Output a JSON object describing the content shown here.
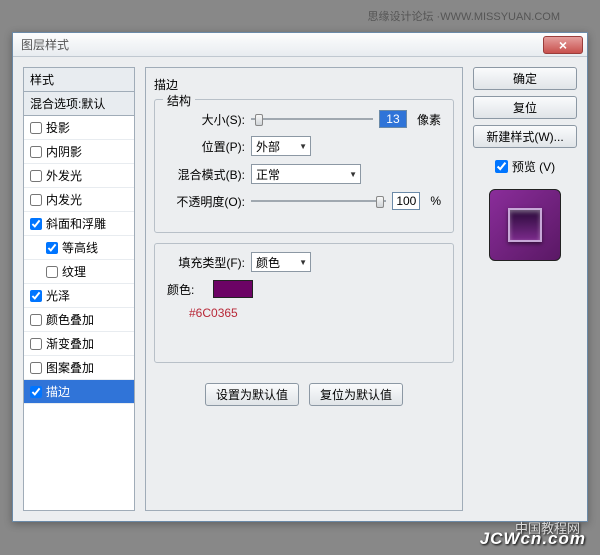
{
  "header_text": "思缘设计论坛 ·WWW.MISSYUAN.COM",
  "dialog": {
    "title": "图层样式"
  },
  "left": {
    "header": "样式",
    "blend": "混合选项:默认",
    "items": [
      {
        "label": "投影",
        "checked": false
      },
      {
        "label": "内阴影",
        "checked": false
      },
      {
        "label": "外发光",
        "checked": false
      },
      {
        "label": "内发光",
        "checked": false
      },
      {
        "label": "斜面和浮雕",
        "checked": true
      },
      {
        "label": "等高线",
        "checked": true,
        "sub": true
      },
      {
        "label": "纹理",
        "checked": false,
        "sub": true
      },
      {
        "label": "光泽",
        "checked": true
      },
      {
        "label": "颜色叠加",
        "checked": false
      },
      {
        "label": "渐变叠加",
        "checked": false
      },
      {
        "label": "图案叠加",
        "checked": false
      },
      {
        "label": "描边",
        "checked": true,
        "selected": true
      }
    ]
  },
  "mid": {
    "title": "描边",
    "structure_legend": "结构",
    "size_label": "大小(S):",
    "size_value": "13",
    "size_unit": "像素",
    "position_label": "位置(P):",
    "position_value": "外部",
    "blendmode_label": "混合模式(B):",
    "blendmode_value": "正常",
    "opacity_label": "不透明度(O):",
    "opacity_value": "100",
    "opacity_unit": "%",
    "filltype_label": "填充类型(F):",
    "filltype_value": "颜色",
    "color_label": "颜色:",
    "color_hex": "#6C0365",
    "btn_default": "设置为默认值",
    "btn_reset": "复位为默认值"
  },
  "right": {
    "ok": "确定",
    "cancel": "复位",
    "newstyle": "新建样式(W)...",
    "preview": "预览 (V)"
  },
  "watermark_cn": "中国教程网",
  "watermark": "JCWcn.com"
}
